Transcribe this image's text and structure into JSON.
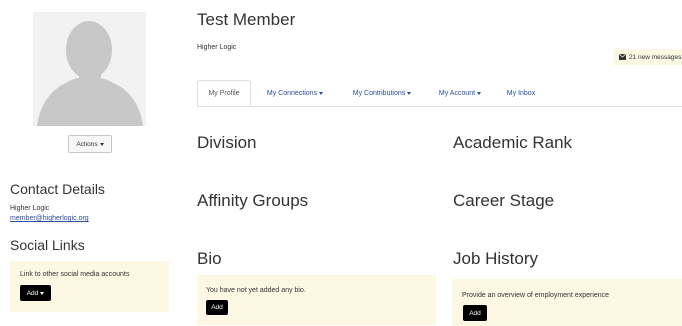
{
  "profile": {
    "actions_label": "Actions"
  },
  "contact": {
    "title": "Contact Details",
    "org": "Higher Logic",
    "email": "member@higherlogic.org"
  },
  "social": {
    "title": "Social Links",
    "text": "Link to other social media accounts",
    "add_label": "Add"
  },
  "header": {
    "name": "Test Member",
    "org": "Higher Logic",
    "messages": "21 new messages"
  },
  "tabs": [
    {
      "label": "My Profile",
      "dropdown": false,
      "active": true
    },
    {
      "label": "My Connections",
      "dropdown": true
    },
    {
      "label": "My Contributions",
      "dropdown": true
    },
    {
      "label": "My Account",
      "dropdown": true
    },
    {
      "label": "My Inbox",
      "dropdown": false
    }
  ],
  "sections": {
    "division": "Division",
    "academic_rank": "Academic Rank",
    "affinity_groups": "Affinity Groups",
    "career_stage": "Career Stage",
    "bio": "Bio",
    "job_history": "Job History"
  },
  "bio": {
    "text": "You have not yet added any bio.",
    "add_label": "Add"
  },
  "job_history": {
    "text": "Provide an overview of employment experience",
    "add_label": "Add"
  }
}
